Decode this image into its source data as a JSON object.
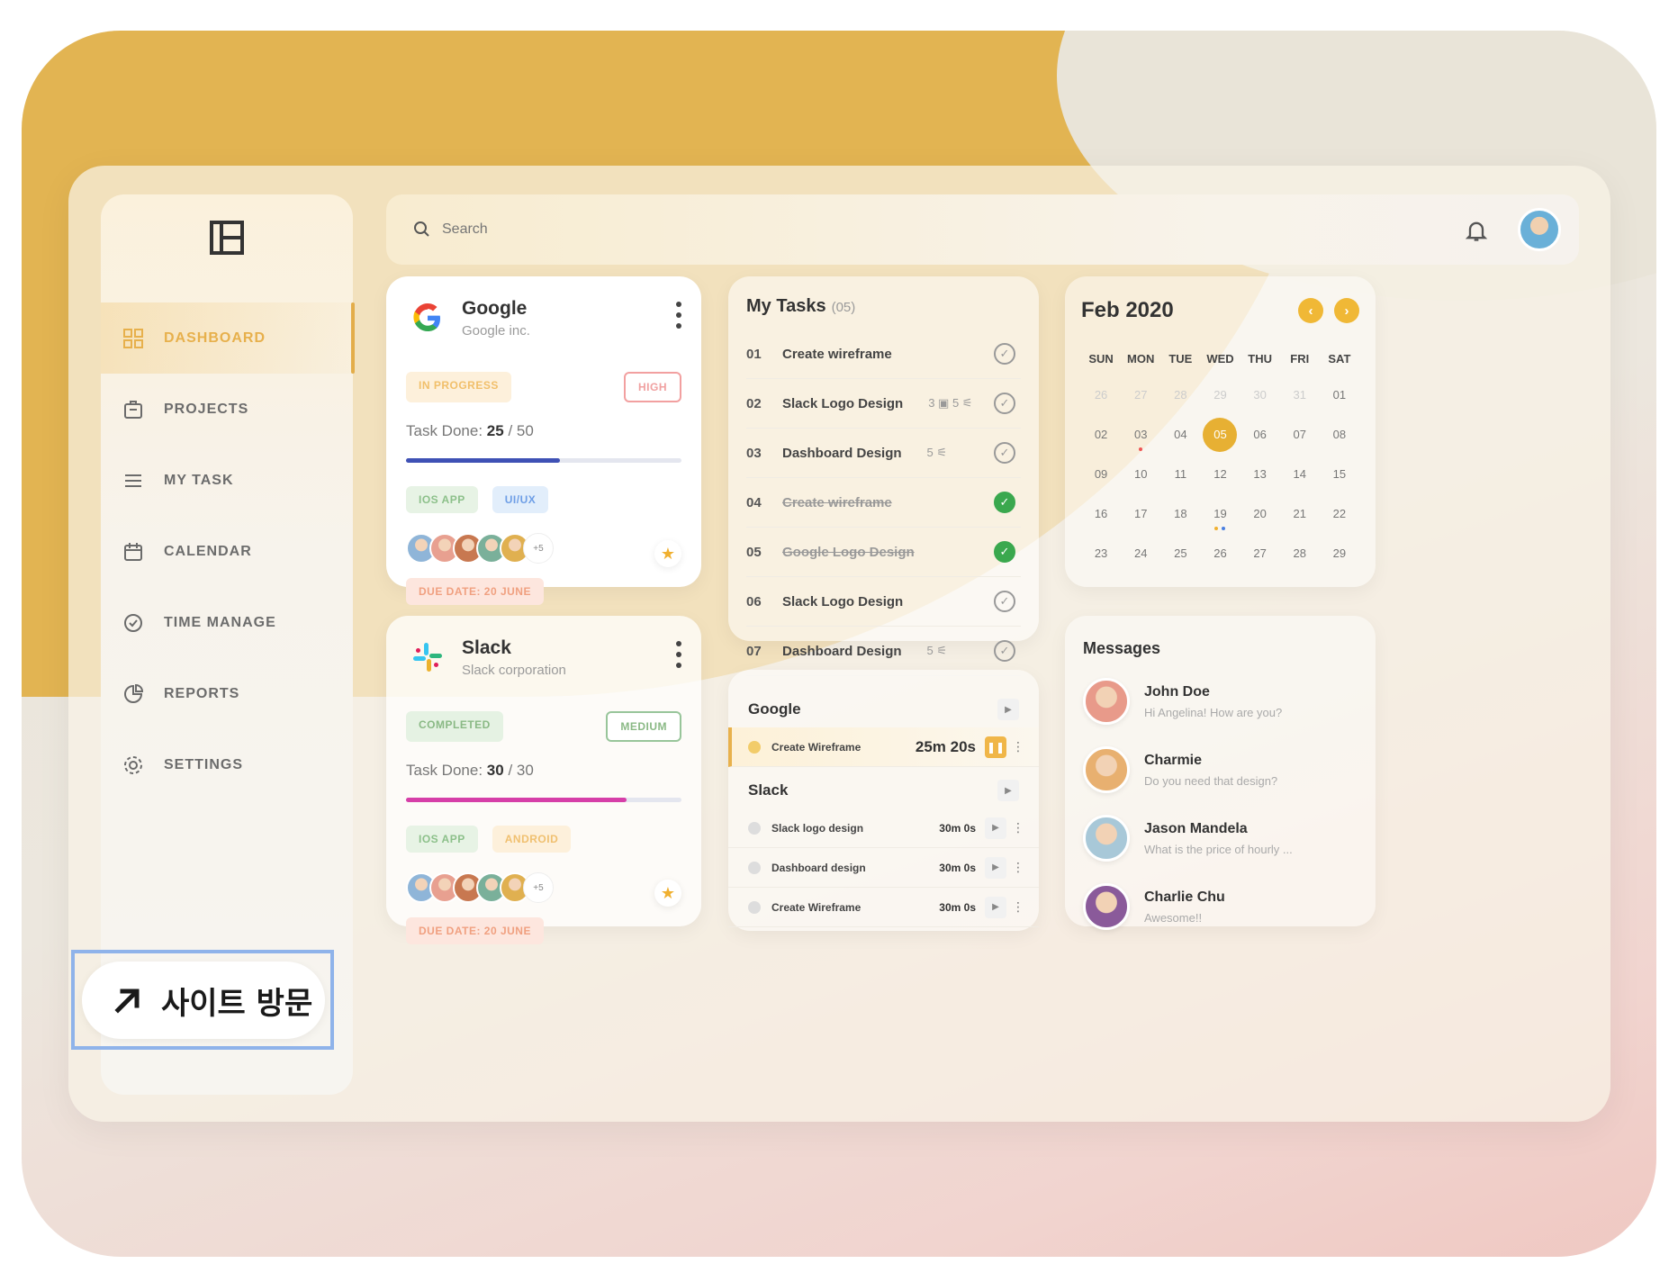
{
  "search": {
    "placeholder": "Search"
  },
  "sidebar": {
    "items": [
      {
        "label": "DASHBOARD",
        "icon": "grid-icon",
        "active": true
      },
      {
        "label": "PROJECTS",
        "icon": "briefcase-icon"
      },
      {
        "label": "MY TASK",
        "icon": "list-icon"
      },
      {
        "label": "CALENDAR",
        "icon": "calendar-icon"
      },
      {
        "label": "TIME MANAGE",
        "icon": "clock-icon"
      },
      {
        "label": "REPORTS",
        "icon": "pie-chart-icon"
      },
      {
        "label": "SETTINGS",
        "icon": "gear-icon"
      }
    ]
  },
  "projects": [
    {
      "name": "Google",
      "company": "Google inc.",
      "status": "IN PROGRESS",
      "priority": "HIGH",
      "task_label": "Task Done:",
      "done": "25",
      "total": "/ 50",
      "progress": 0.56,
      "bar_color": "#3f51b5",
      "tags": [
        "IOS APP",
        "UI/UX"
      ],
      "more": "+5",
      "due": "DUE DATE: 20 JUNE"
    },
    {
      "name": "Slack",
      "company": "Slack corporation",
      "status": "COMPLETED",
      "priority": "MEDIUM",
      "task_label": "Task Done:",
      "done": "30",
      "total": "/ 30",
      "progress": 0.8,
      "bar_color": "#d63ea8",
      "tags": [
        "IOS APP",
        "ANDROID"
      ],
      "more": "+5",
      "due": "DUE DATE: 20 JUNE"
    }
  ],
  "tasks": {
    "title": "My Tasks",
    "count": "(05)",
    "items": [
      {
        "n": "01",
        "t": "Create wireframe",
        "meta": "",
        "done": false
      },
      {
        "n": "02",
        "t": "Slack Logo Design",
        "meta": "3 ▣   5 ⚟",
        "done": false
      },
      {
        "n": "03",
        "t": "Dashboard Design",
        "meta": "5 ⚟",
        "done": false
      },
      {
        "n": "04",
        "t": "Create wireframe",
        "meta": "",
        "done": true
      },
      {
        "n": "05",
        "t": "Google Logo Design",
        "meta": "",
        "done": true
      },
      {
        "n": "06",
        "t": "Slack Logo Design",
        "meta": "",
        "done": false
      },
      {
        "n": "07",
        "t": "Dashboard Design",
        "meta": "5 ⚟",
        "done": false
      }
    ]
  },
  "timer": {
    "groups": [
      {
        "name": "Google",
        "tracks": [
          {
            "name": "Create Wireframe",
            "time": "25m 20s",
            "active": true
          }
        ]
      },
      {
        "name": "Slack",
        "tracks": [
          {
            "name": "Slack logo design",
            "time": "30m 0s"
          },
          {
            "name": "Dashboard design",
            "time": "30m 0s"
          },
          {
            "name": "Create Wireframe",
            "time": "30m 0s"
          }
        ]
      }
    ]
  },
  "calendar": {
    "month": "Feb 2020",
    "dow": [
      "SUN",
      "MON",
      "TUE",
      "WED",
      "THU",
      "FRI",
      "SAT"
    ],
    "weeks": [
      [
        "26",
        "27",
        "28",
        "29",
        "30",
        "31",
        "01"
      ],
      [
        "02",
        "03",
        "04",
        "05",
        "06",
        "07",
        "08"
      ],
      [
        "09",
        "10",
        "11",
        "12",
        "13",
        "14",
        "15"
      ],
      [
        "16",
        "17",
        "18",
        "19",
        "20",
        "21",
        "22"
      ],
      [
        "23",
        "24",
        "25",
        "26",
        "27",
        "28",
        "29"
      ]
    ],
    "today": "05",
    "accent": "#e7b033"
  },
  "messages": {
    "title": "Messages",
    "items": [
      {
        "name": "John Doe",
        "text": "Hi Angelina! How are you?",
        "color": "#e89a8a"
      },
      {
        "name": "Charmie",
        "text": "Do you need that design?",
        "color": "#e8b070"
      },
      {
        "name": "Jason Mandela",
        "text": "What is the price of hourly ...",
        "color": "#a8c8d8"
      },
      {
        "name": "Charlie Chu",
        "text": "Awesome!!",
        "color": "#8a5a9a"
      }
    ]
  },
  "visit": {
    "label": "사이트 방문"
  }
}
